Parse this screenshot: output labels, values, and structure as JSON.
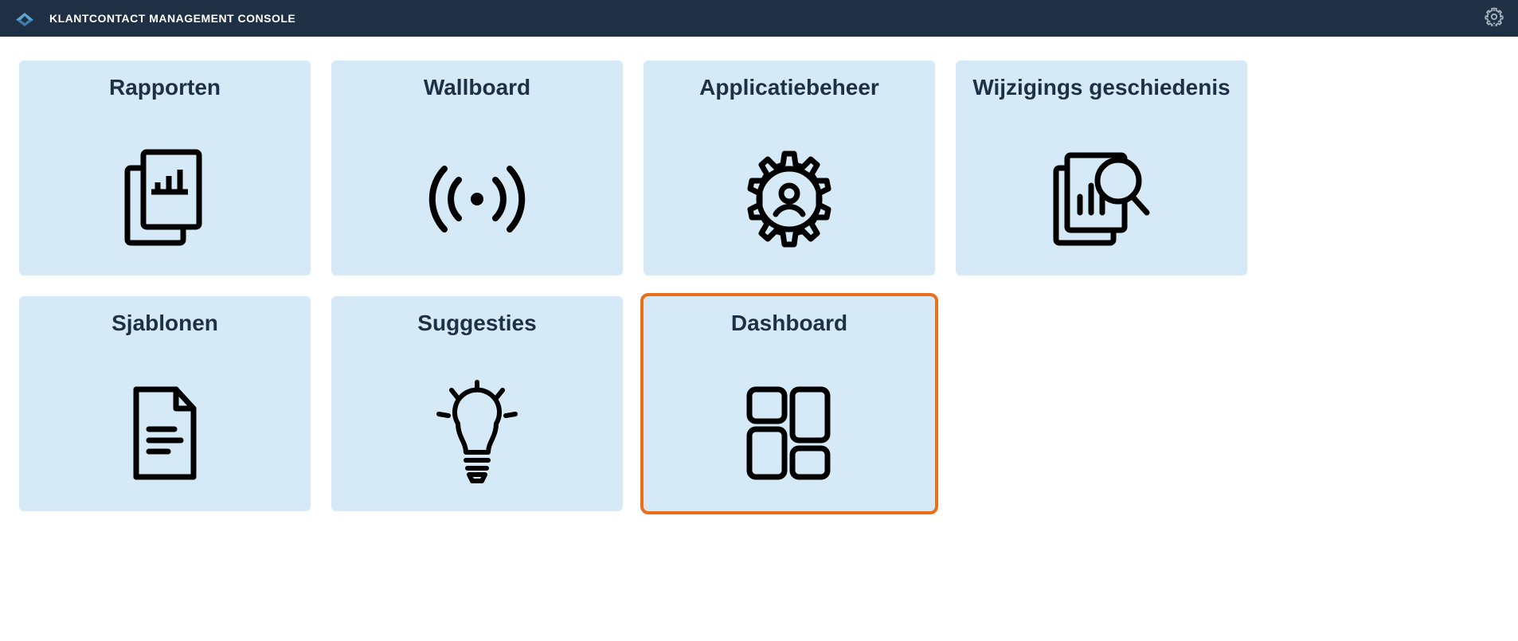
{
  "header": {
    "title": "KLANTCONTACT MANAGEMENT CONSOLE"
  },
  "tiles": [
    {
      "label": "Rapporten",
      "icon": "reports-icon",
      "highlighted": false
    },
    {
      "label": "Wallboard",
      "icon": "broadcast-icon",
      "highlighted": false
    },
    {
      "label": "Applicatiebeheer",
      "icon": "user-gear-icon",
      "highlighted": false
    },
    {
      "label": "Wijzigings geschiedenis",
      "icon": "chart-magnify-icon",
      "highlighted": false
    },
    {
      "label": "Sjablonen",
      "icon": "document-icon",
      "highlighted": false
    },
    {
      "label": "Suggesties",
      "icon": "lightbulb-icon",
      "highlighted": false
    },
    {
      "label": "Dashboard",
      "icon": "dashboard-icon",
      "highlighted": true
    }
  ]
}
